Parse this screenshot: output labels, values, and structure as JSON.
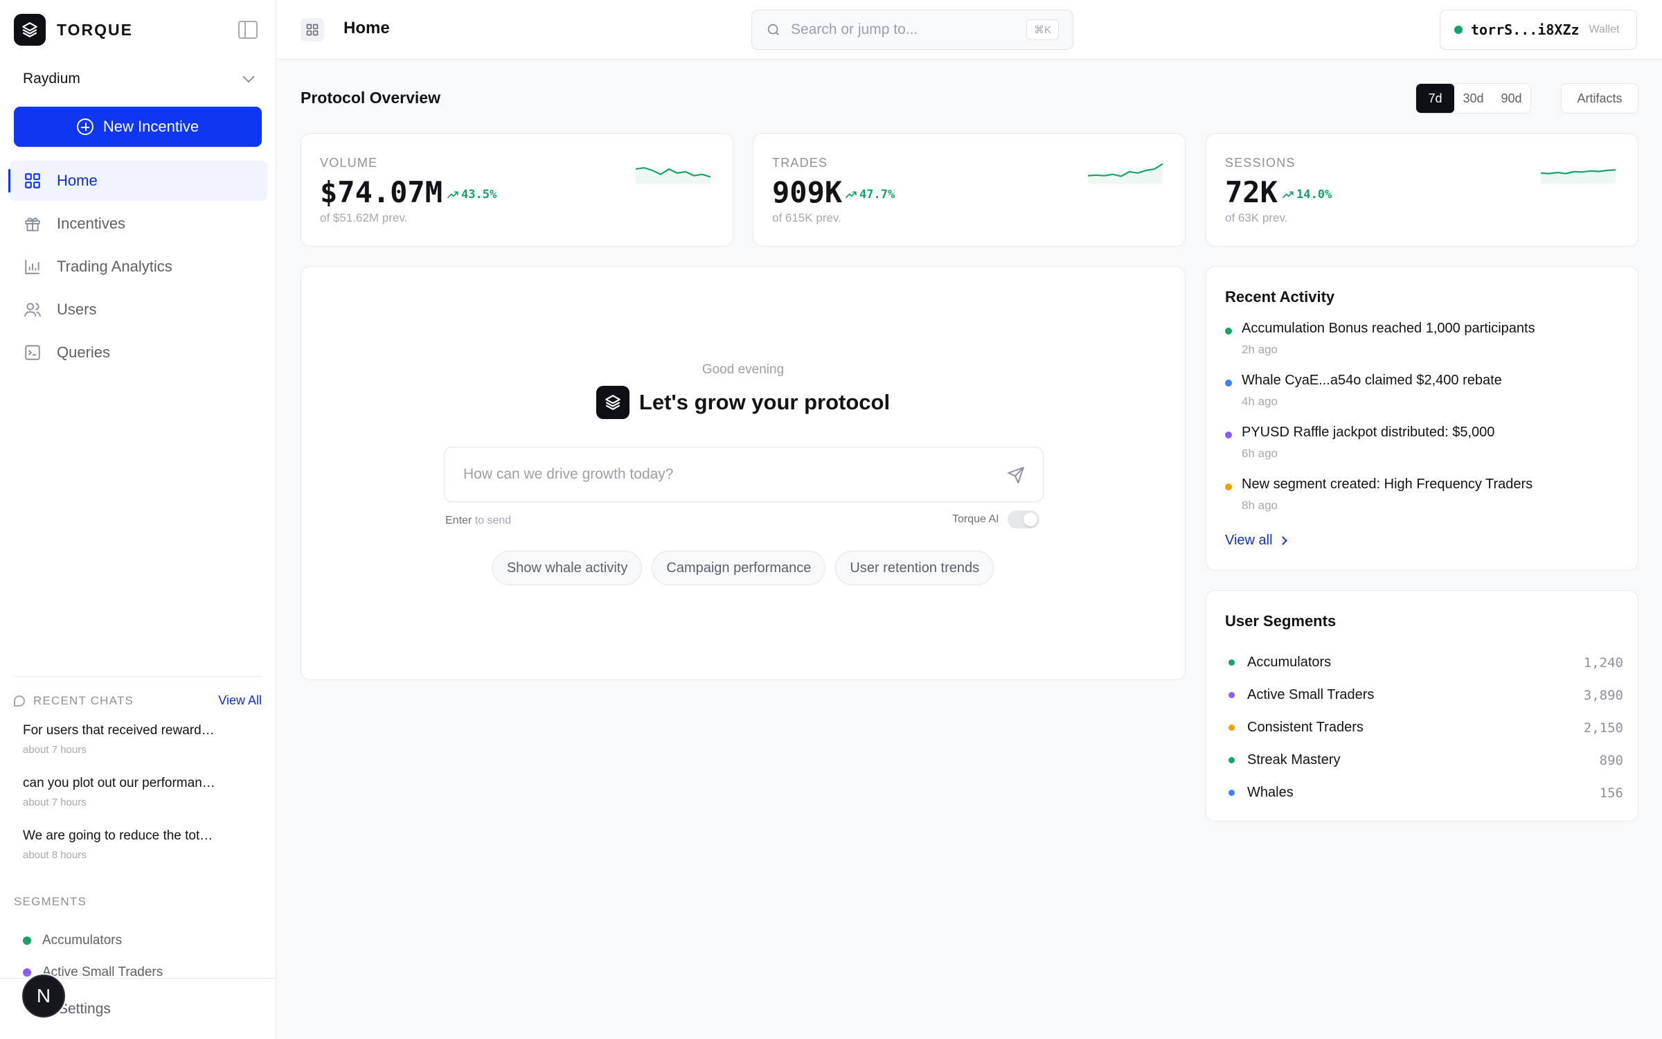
{
  "brand": {
    "name": "TORQUE"
  },
  "workspace": {
    "name": "Raydium"
  },
  "new_incentive": {
    "label": "New Incentive"
  },
  "nav": [
    {
      "label": "Home",
      "icon": "grid-icon",
      "active": true
    },
    {
      "label": "Incentives",
      "icon": "gift-icon",
      "active": false
    },
    {
      "label": "Trading Analytics",
      "icon": "bar-chart-icon",
      "active": false
    },
    {
      "label": "Users",
      "icon": "users-icon",
      "active": false
    },
    {
      "label": "Queries",
      "icon": "terminal-icon",
      "active": false
    }
  ],
  "recent_chats": {
    "title": "RECENT CHATS",
    "view_all": "View All",
    "items": [
      {
        "text": "For users that received reward…",
        "time": "about 7 hours"
      },
      {
        "text": "can you plot out our performan…",
        "time": "about 7 hours"
      },
      {
        "text": "We are going to reduce the tot…",
        "time": "about 8 hours"
      }
    ]
  },
  "sidebar_segments": {
    "title": "SEGMENTS",
    "items": [
      {
        "name": "Accumulators",
        "color": "#16a36a"
      },
      {
        "name": "Active Small Traders",
        "color": "#8b5cf6"
      }
    ]
  },
  "settings": {
    "label": "Settings"
  },
  "avatar": {
    "letter": "N"
  },
  "topbar": {
    "title": "Home",
    "search_placeholder": "Search or jump to...",
    "search_shortcut": "⌘K",
    "wallet_address": "torrS...i8XZz",
    "wallet_label": "Wallet"
  },
  "overview": {
    "title": "Protocol Overview",
    "ranges": [
      "7d",
      "30d",
      "90d"
    ],
    "active_range": "7d",
    "artifacts": "Artifacts"
  },
  "metrics": [
    {
      "label": "VOLUME",
      "value": "$74.07M",
      "change": "43.5%",
      "prev": "of $51.62M prev.",
      "spark": [
        0.55,
        0.6,
        0.5,
        0.35,
        0.55,
        0.4,
        0.45,
        0.3,
        0.35,
        0.25
      ]
    },
    {
      "label": "TRADES",
      "value": "909K",
      "change": "47.7%",
      "prev": "of 615K prev.",
      "spark": [
        0.3,
        0.32,
        0.3,
        0.35,
        0.28,
        0.45,
        0.4,
        0.5,
        0.55,
        0.75
      ]
    },
    {
      "label": "SESSIONS",
      "value": "72K",
      "change": "14.0%",
      "prev": "of 63K prev.",
      "spark": [
        0.4,
        0.38,
        0.42,
        0.38,
        0.45,
        0.44,
        0.48,
        0.46,
        0.5,
        0.52
      ]
    }
  ],
  "hero": {
    "greeting": "Good evening",
    "title": "Let's grow your protocol",
    "prompt_placeholder": "How can we drive growth today?",
    "hint_key": "Enter",
    "hint_rest": " to send",
    "ai_label": "Torque AI",
    "chips": [
      "Show whale activity",
      "Campaign performance",
      "User retention trends"
    ]
  },
  "activity": {
    "title": "Recent Activity",
    "items": [
      {
        "text": "Accumulation Bonus reached 1,000 participants",
        "time": "2h ago",
        "color": "#16a36a"
      },
      {
        "text": "Whale CyaE...a54o claimed $2,400 rebate",
        "time": "4h ago",
        "color": "#3b82f6"
      },
      {
        "text": "PYUSD Raffle jackpot distributed: $5,000",
        "time": "6h ago",
        "color": "#8b5cf6"
      },
      {
        "text": "New segment created: High Frequency Traders",
        "time": "8h ago",
        "color": "#f59e0b"
      }
    ],
    "view_all": "View all"
  },
  "segments": {
    "title": "User Segments",
    "items": [
      {
        "name": "Accumulators",
        "count": "1,240",
        "color": "#16a36a"
      },
      {
        "name": "Active Small Traders",
        "count": "3,890",
        "color": "#8b5cf6"
      },
      {
        "name": "Consistent Traders",
        "count": "2,150",
        "color": "#f59e0b"
      },
      {
        "name": "Streak Mastery",
        "count": "890",
        "color": "#16a36a"
      },
      {
        "name": "Whales",
        "count": "156",
        "color": "#3b82f6"
      }
    ]
  }
}
